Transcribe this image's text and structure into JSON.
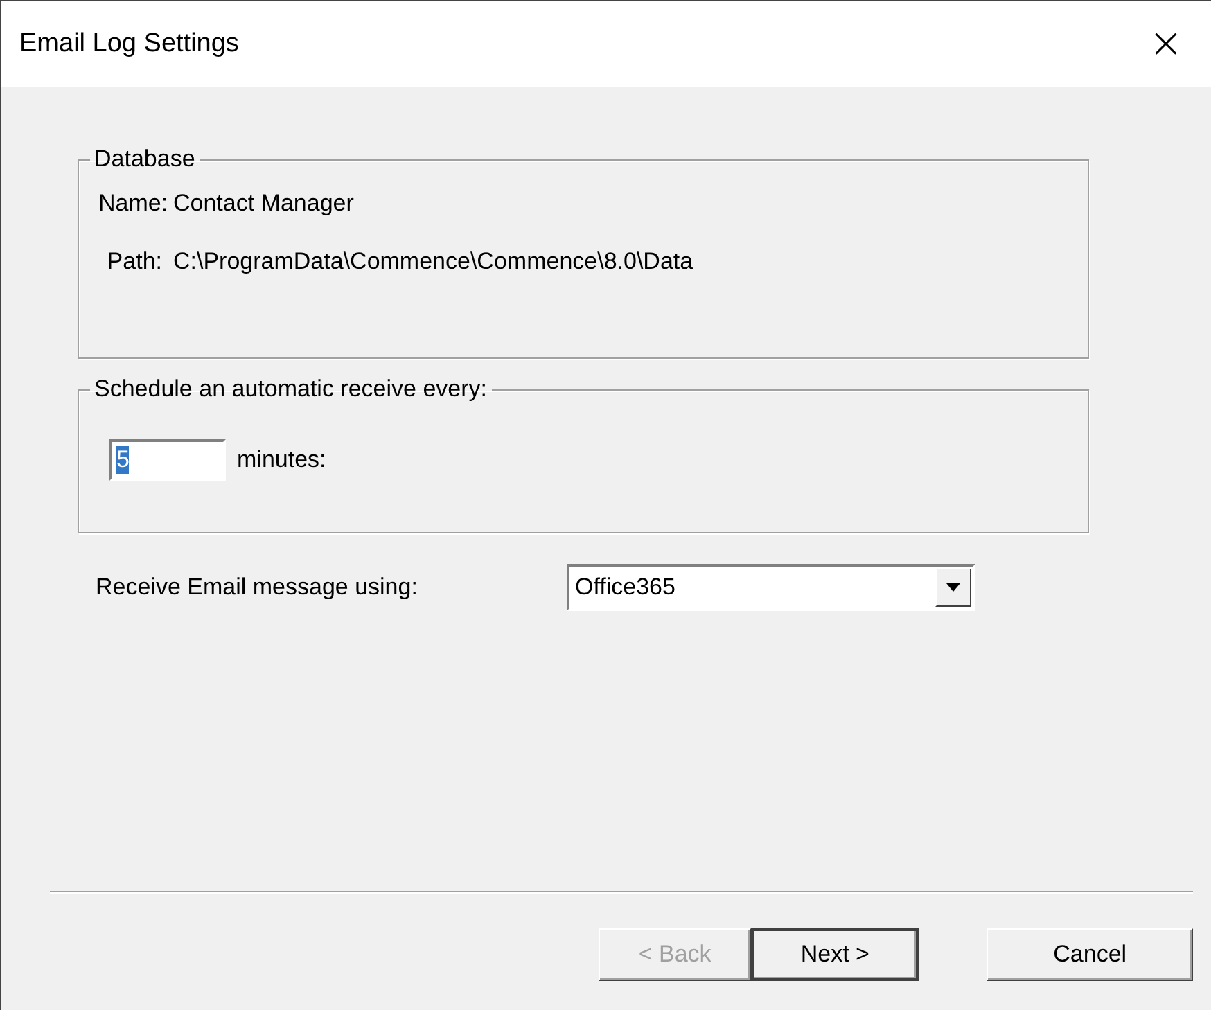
{
  "window": {
    "title": "Email Log Settings",
    "close": "×"
  },
  "database": {
    "legend": "Database",
    "fields": [
      {
        "label": "Name:",
        "value": "Contact Manager"
      },
      {
        "label": "Path:",
        "value": "C:\\ProgramData\\Commence\\Commence\\8.0\\Data"
      }
    ]
  },
  "schedule": {
    "legend": "Schedule an automatic receive every:",
    "value": "5",
    "value_selected": true,
    "unit": "minutes:"
  },
  "receive": {
    "label": "Receive Email message using:",
    "value": "Office365"
  },
  "buttons": [
    {
      "label": "< Back",
      "disabled": true,
      "default": false
    },
    {
      "label": "Next >",
      "disabled": false,
      "default": true
    },
    {
      "label": "Cancel",
      "disabled": false,
      "default": false
    }
  ]
}
